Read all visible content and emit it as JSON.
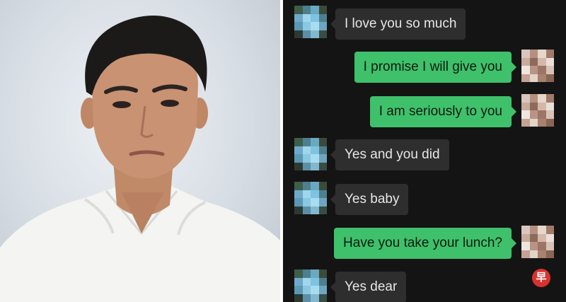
{
  "photo": {
    "subject": "portrait-of-man-in-white-shirt"
  },
  "chat": {
    "messages": [
      {
        "direction": "incoming",
        "text": "I love you so much"
      },
      {
        "direction": "outgoing",
        "text": "I promise I will give you"
      },
      {
        "direction": "outgoing",
        "text": "I am seriously to you"
      },
      {
        "direction": "incoming",
        "text": "Yes and you did"
      },
      {
        "direction": "incoming",
        "text": "Yes baby"
      },
      {
        "direction": "outgoing",
        "text": "Have you take your lunch?"
      },
      {
        "direction": "incoming",
        "text": "Yes dear"
      }
    ]
  },
  "watermark": {
    "glyph": "早"
  },
  "colors": {
    "chat_background": "#141414",
    "incoming_bubble": "#2e2e2e",
    "outgoing_bubble": "#3ec16a",
    "watermark": "#d9322f"
  },
  "icons": {
    "contact_avatar": "blurred-contact-avatar-icon",
    "self_avatar": "blurred-self-avatar-icon"
  }
}
